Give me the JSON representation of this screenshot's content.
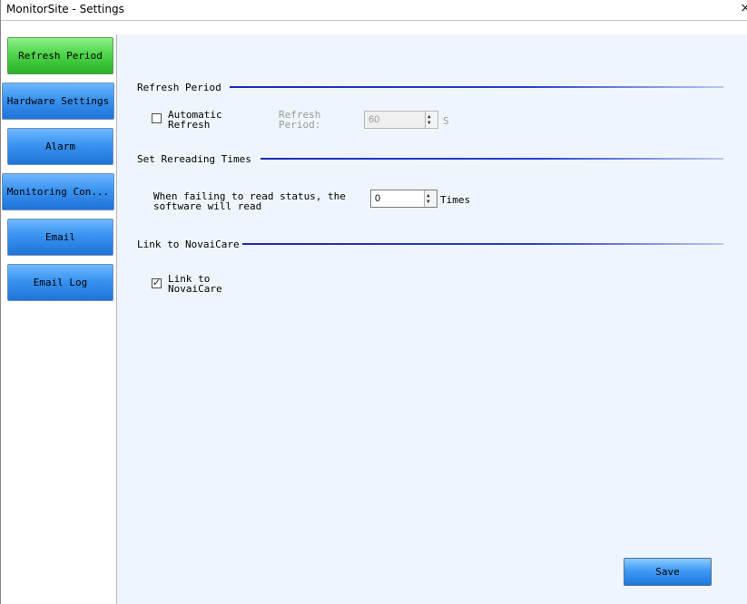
{
  "window": {
    "title": "MonitorSite - Settings",
    "close_glyph": "×"
  },
  "sidebar": {
    "items": [
      {
        "label": "Refresh Period",
        "active": true
      },
      {
        "label": "Hardware Settings",
        "active": false
      },
      {
        "label": "Alarm",
        "active": false
      },
      {
        "label": "Monitoring Con...",
        "active": false
      },
      {
        "label": "Email",
        "active": false
      },
      {
        "label": "Email Log",
        "active": false
      }
    ]
  },
  "refresh_period": {
    "heading": "Refresh Period",
    "automatic_refresh": {
      "label_line1": "Automatic",
      "label_line2": "Refresh",
      "checked": false
    },
    "period_label_line1": "Refresh",
    "period_label_line2": "Period:",
    "period_value": "60",
    "period_unit": "S",
    "enabled": false
  },
  "rereading": {
    "heading": "Set Rereading Times",
    "desc_line1": "When failing to read status, the",
    "desc_line2": "software will read",
    "value": "0",
    "unit": "Times"
  },
  "novaicare": {
    "heading": "Link to NovaiCare",
    "link": {
      "label_line1": "Link to",
      "label_line2": "NovaiCare",
      "checked": true
    }
  },
  "actions": {
    "save_label": "Save"
  },
  "colors": {
    "active_nav": "#4fd64a",
    "nav": "#3a93f0",
    "panel_bg": "#eef5fd",
    "rule": "#1f2db5"
  }
}
